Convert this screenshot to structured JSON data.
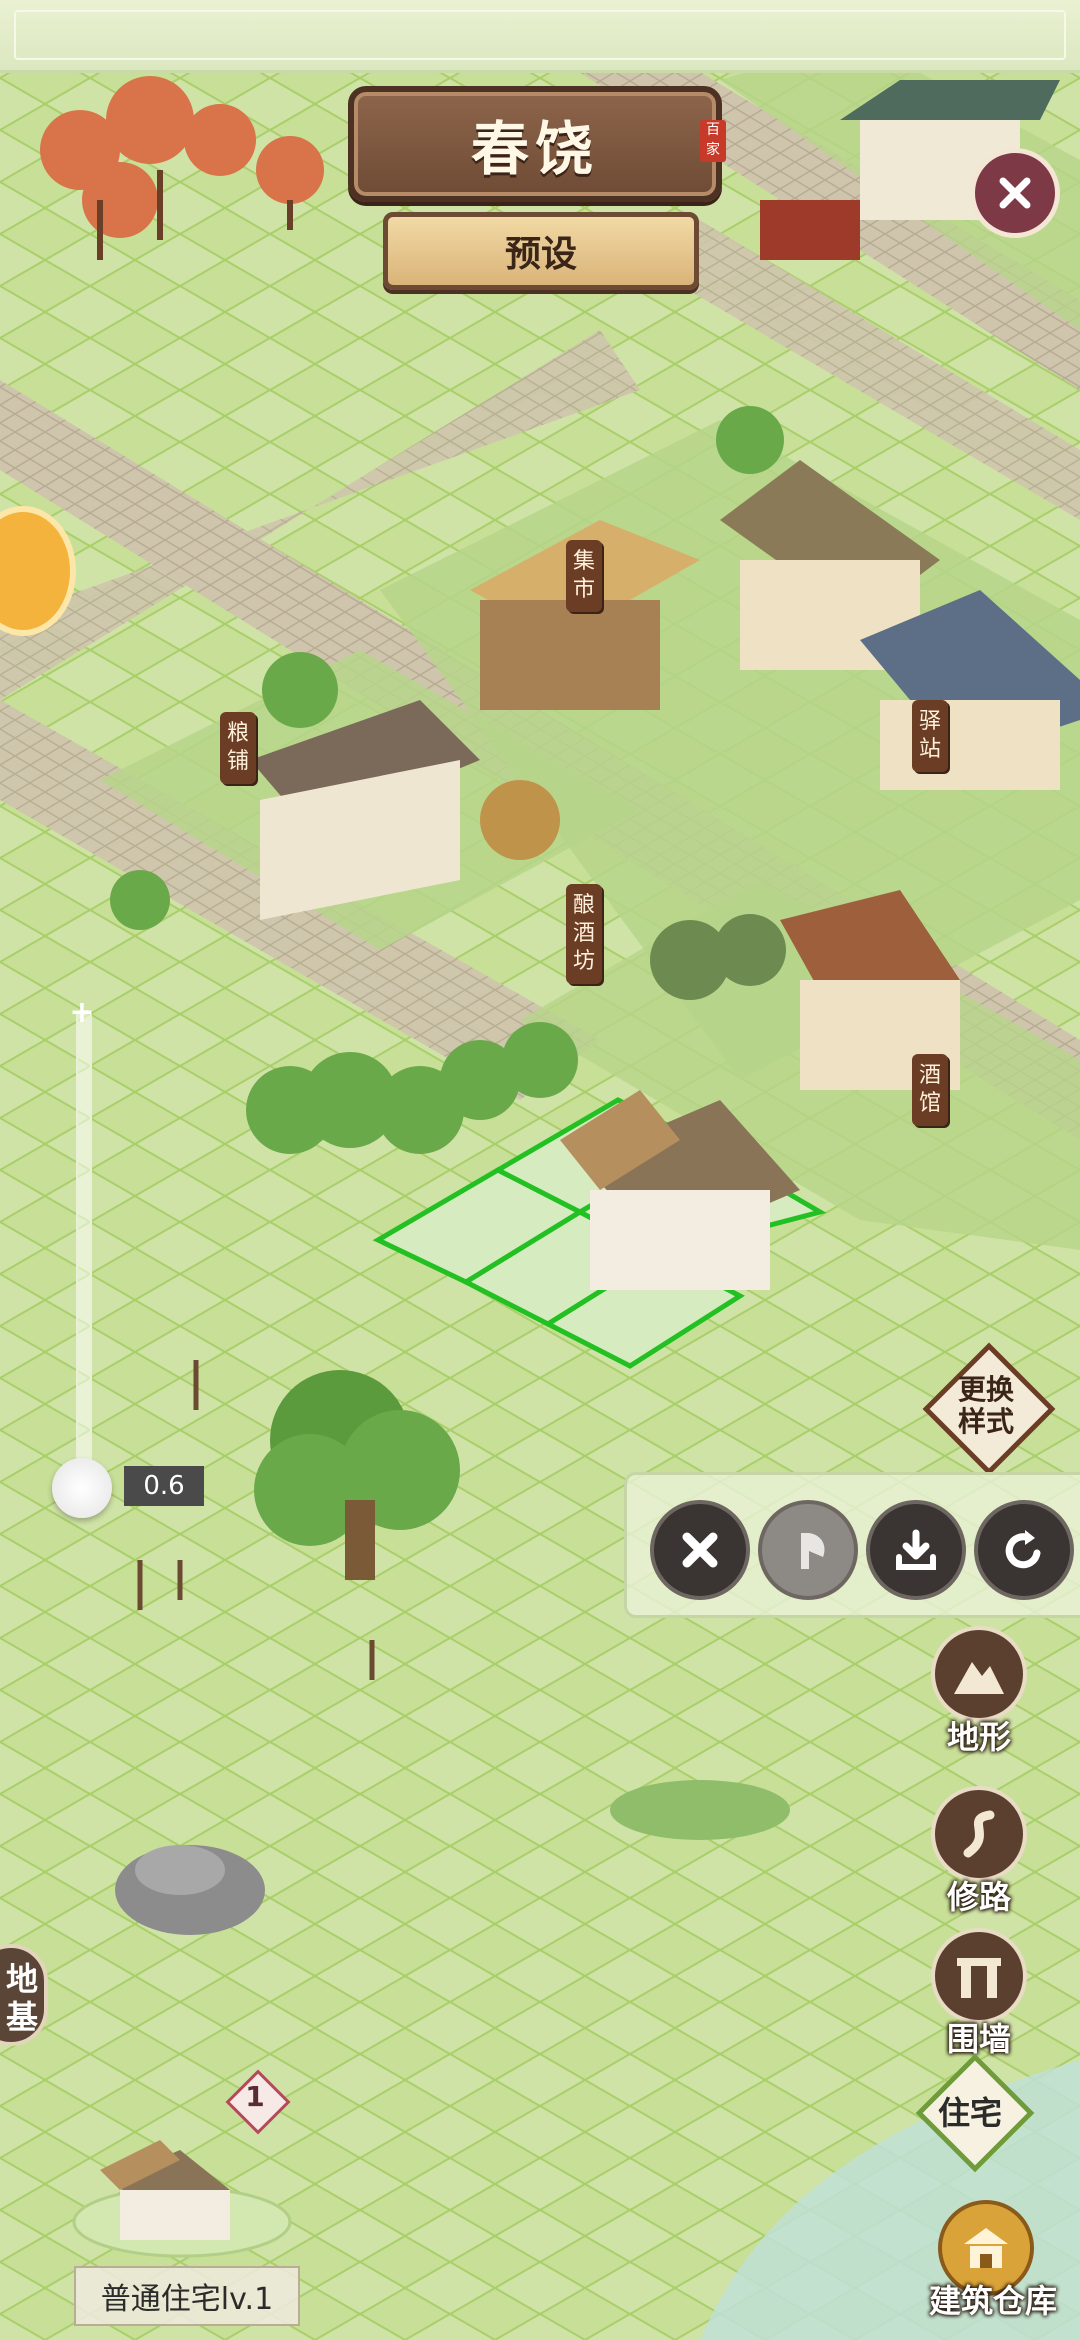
{
  "header": {
    "title": "春饶",
    "seal": "百家",
    "preset_label": "预设"
  },
  "map": {
    "buildings": [
      {
        "key": "market",
        "label": "集市"
      },
      {
        "key": "granary",
        "label": "粮铺"
      },
      {
        "key": "post-station",
        "label": "驿站"
      },
      {
        "key": "brewery",
        "label": "酿酒坊"
      },
      {
        "key": "tavern",
        "label": "酒馆"
      }
    ]
  },
  "zoom": {
    "value": "0.6",
    "plus_symbol": "+"
  },
  "actions": {
    "swap_style_line1": "更换",
    "swap_style_line2": "样式",
    "cancel_icon": "close-icon",
    "demolish_icon": "axe-icon",
    "store_icon": "download-icon",
    "rotate_icon": "rotate-icon",
    "demolish_disabled": true
  },
  "tools": {
    "terrain": "地形",
    "build_road": "修路",
    "wall": "围墙",
    "residence": "住宅",
    "warehouse": "建筑仓库",
    "foundation_line1": "地",
    "foundation_line2": "基"
  },
  "selection": {
    "count": "1",
    "item_name": "普通住宅lv.1"
  },
  "colors": {
    "grass": "#cfe3a6",
    "grid_line": "#a9cf6a",
    "placement_outline": "#22c022",
    "plaque_brown": "#7a5340",
    "sign_brown": "#6b3d25",
    "road": "#c9bfa6"
  }
}
